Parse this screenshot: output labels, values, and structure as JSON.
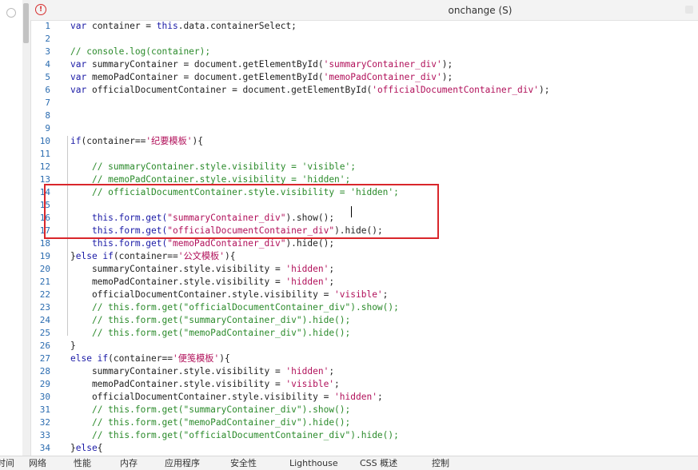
{
  "window": {
    "title": "onchange (S)"
  },
  "code_lines": [
    {
      "n": "1",
      "tokens": [
        {
          "t": "kw",
          "v": "var "
        },
        {
          "t": "pl",
          "v": "container = "
        },
        {
          "t": "kw",
          "v": "this"
        },
        {
          "t": "pl",
          "v": ".data.containerSelect;"
        }
      ]
    },
    {
      "n": "2",
      "tokens": []
    },
    {
      "n": "3",
      "tokens": [
        {
          "t": "cm",
          "v": "// console.log(container);"
        }
      ]
    },
    {
      "n": "4",
      "tokens": [
        {
          "t": "kw",
          "v": "var "
        },
        {
          "t": "pl",
          "v": "summaryContainer = document.getElementById("
        },
        {
          "t": "st",
          "v": "'summaryContainer_div'"
        },
        {
          "t": "pl",
          "v": ");"
        }
      ]
    },
    {
      "n": "5",
      "tokens": [
        {
          "t": "kw",
          "v": "var "
        },
        {
          "t": "pl",
          "v": "memoPadContainer = document.getElementById("
        },
        {
          "t": "st",
          "v": "'memoPadContainer_div'"
        },
        {
          "t": "pl",
          "v": ");"
        }
      ]
    },
    {
      "n": "6",
      "tokens": [
        {
          "t": "kw",
          "v": "var "
        },
        {
          "t": "pl",
          "v": "officialDocumentContainer = document.getElementById("
        },
        {
          "t": "st",
          "v": "'officialDocumentContainer_div'"
        },
        {
          "t": "pl",
          "v": ");"
        }
      ]
    },
    {
      "n": "7",
      "tokens": []
    },
    {
      "n": "8",
      "tokens": []
    },
    {
      "n": "9",
      "tokens": []
    },
    {
      "n": "10",
      "tokens": [
        {
          "t": "kw",
          "v": "if"
        },
        {
          "t": "pl",
          "v": "(container=="
        },
        {
          "t": "st",
          "v": "'纪要模板'"
        },
        {
          "t": "pl",
          "v": "){"
        }
      ]
    },
    {
      "n": "11",
      "tokens": []
    },
    {
      "n": "12",
      "tokens": [
        {
          "t": "pl",
          "v": "    "
        },
        {
          "t": "cm",
          "v": "// summaryContainer.style.visibility = 'visible';"
        }
      ]
    },
    {
      "n": "13",
      "tokens": [
        {
          "t": "pl",
          "v": "    "
        },
        {
          "t": "cm",
          "v": "// memoPadContainer.style.visibility = 'hidden';"
        }
      ]
    },
    {
      "n": "14",
      "tokens": [
        {
          "t": "pl",
          "v": "    "
        },
        {
          "t": "cm",
          "v": "// officialDocumentContainer.style.visibility = 'hidden';"
        }
      ]
    },
    {
      "n": "15",
      "tokens": []
    },
    {
      "n": "16",
      "tokens": [
        {
          "t": "pl",
          "v": "    "
        },
        {
          "t": "kw",
          "v": "this.form.get("
        },
        {
          "t": "st",
          "v": "\"summaryContainer_div\""
        },
        {
          "t": "pl",
          "v": ").show();"
        }
      ]
    },
    {
      "n": "17",
      "tokens": [
        {
          "t": "pl",
          "v": "    "
        },
        {
          "t": "kw",
          "v": "this.form.get("
        },
        {
          "t": "st",
          "v": "\"officialDocumentContainer_div\""
        },
        {
          "t": "pl",
          "v": ").hide();"
        }
      ]
    },
    {
      "n": "18",
      "tokens": [
        {
          "t": "pl",
          "v": "    "
        },
        {
          "t": "kw",
          "v": "this.form.get("
        },
        {
          "t": "st",
          "v": "\"memoPadContainer_div\""
        },
        {
          "t": "pl",
          "v": ").hide();"
        }
      ]
    },
    {
      "n": "19",
      "tokens": [
        {
          "t": "pl",
          "v": "}"
        },
        {
          "t": "kw",
          "v": "else if"
        },
        {
          "t": "pl",
          "v": "(container=="
        },
        {
          "t": "st",
          "v": "'公文模板'"
        },
        {
          "t": "pl",
          "v": "){"
        }
      ]
    },
    {
      "n": "20",
      "tokens": [
        {
          "t": "pl",
          "v": "    summaryContainer.style.visibility = "
        },
        {
          "t": "st",
          "v": "'hidden'"
        },
        {
          "t": "pl",
          "v": ";"
        }
      ]
    },
    {
      "n": "21",
      "tokens": [
        {
          "t": "pl",
          "v": "    memoPadContainer.style.visibility = "
        },
        {
          "t": "st",
          "v": "'hidden'"
        },
        {
          "t": "pl",
          "v": ";"
        }
      ]
    },
    {
      "n": "22",
      "tokens": [
        {
          "t": "pl",
          "v": "    officialDocumentContainer.style.visibility = "
        },
        {
          "t": "st",
          "v": "'visible'"
        },
        {
          "t": "pl",
          "v": ";"
        }
      ]
    },
    {
      "n": "23",
      "tokens": [
        {
          "t": "pl",
          "v": "    "
        },
        {
          "t": "cm",
          "v": "// this.form.get(\"officialDocumentContainer_div\").show();"
        }
      ]
    },
    {
      "n": "24",
      "tokens": [
        {
          "t": "pl",
          "v": "    "
        },
        {
          "t": "cm",
          "v": "// this.form.get(\"summaryContainer_div\").hide();"
        }
      ]
    },
    {
      "n": "25",
      "tokens": [
        {
          "t": "pl",
          "v": "    "
        },
        {
          "t": "cm",
          "v": "// this.form.get(\"memoPadContainer_div\").hide();"
        }
      ]
    },
    {
      "n": "26",
      "tokens": [
        {
          "t": "pl",
          "v": "}"
        }
      ]
    },
    {
      "n": "27",
      "tokens": [
        {
          "t": "kw",
          "v": "else if"
        },
        {
          "t": "pl",
          "v": "(container=="
        },
        {
          "t": "st",
          "v": "'便笺模板'"
        },
        {
          "t": "pl",
          "v": "){"
        }
      ]
    },
    {
      "n": "28",
      "tokens": [
        {
          "t": "pl",
          "v": "    summaryContainer.style.visibility = "
        },
        {
          "t": "st",
          "v": "'hidden'"
        },
        {
          "t": "pl",
          "v": ";"
        }
      ]
    },
    {
      "n": "29",
      "tokens": [
        {
          "t": "pl",
          "v": "    memoPadContainer.style.visibility = "
        },
        {
          "t": "st",
          "v": "'visible'"
        },
        {
          "t": "pl",
          "v": ";"
        }
      ]
    },
    {
      "n": "30",
      "tokens": [
        {
          "t": "pl",
          "v": "    officialDocumentContainer.style.visibility = "
        },
        {
          "t": "st",
          "v": "'hidden'"
        },
        {
          "t": "pl",
          "v": ";"
        }
      ]
    },
    {
      "n": "31",
      "tokens": [
        {
          "t": "pl",
          "v": "    "
        },
        {
          "t": "cm",
          "v": "// this.form.get(\"summaryContainer_div\").show();"
        }
      ]
    },
    {
      "n": "32",
      "tokens": [
        {
          "t": "pl",
          "v": "    "
        },
        {
          "t": "cm",
          "v": "// this.form.get(\"memoPadContainer_div\").hide();"
        }
      ]
    },
    {
      "n": "33",
      "tokens": [
        {
          "t": "pl",
          "v": "    "
        },
        {
          "t": "cm",
          "v": "// this.form.get(\"officialDocumentContainer_div\").hide();"
        }
      ]
    },
    {
      "n": "34",
      "tokens": [
        {
          "t": "pl",
          "v": "}"
        },
        {
          "t": "kw",
          "v": "else"
        },
        {
          "t": "pl",
          "v": "{"
        }
      ]
    }
  ],
  "status_tabs": [
    "时间",
    "网络",
    "性能",
    "内存",
    "应用程序",
    "安全性",
    "Lighthouse",
    "CSS 概述",
    "控制"
  ],
  "colors": {
    "keyword": "#1a1aa6",
    "comment": "#2a8a2a",
    "string": "#b1105a",
    "line_number": "#2b6cb0",
    "highlight_box": "#d9262b"
  }
}
